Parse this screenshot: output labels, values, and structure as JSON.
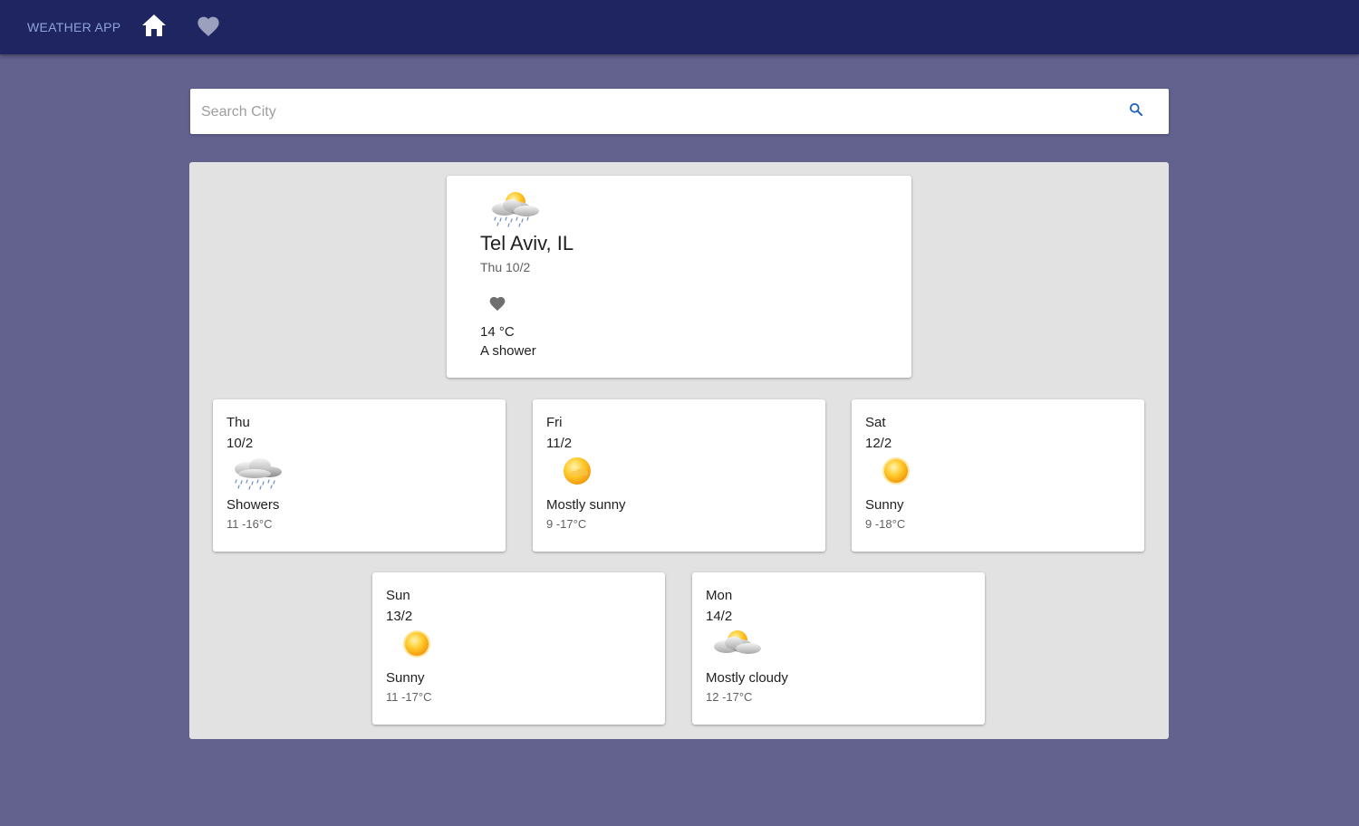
{
  "app": {
    "title": "WEATHER APP",
    "home_icon": "home-icon",
    "favorites_icon": "heart-icon",
    "colors": {
      "appbar": "#1f2561",
      "background": "#63618e",
      "panel": "#e2e2e2",
      "search_icon": "#1e63c4"
    }
  },
  "search": {
    "placeholder": "Search City",
    "value": "",
    "icon": "search-icon"
  },
  "current": {
    "city": "Tel Aviv, IL",
    "date": "Thu 10/2",
    "temperature": "14 °C",
    "condition": "A shower",
    "icon": "cloud-sun-rain-icon",
    "favorite_icon": "heart-icon"
  },
  "forecast": [
    {
      "day": "Thu",
      "date": "10/2",
      "condition": "Showers",
      "range": "11 -16°C",
      "icon": "showers-icon"
    },
    {
      "day": "Fri",
      "date": "11/2",
      "condition": "Mostly sunny",
      "range": "9 -17°C",
      "icon": "mostly-sunny-icon"
    },
    {
      "day": "Sat",
      "date": "12/2",
      "condition": "Sunny",
      "range": "9 -18°C",
      "icon": "sun-icon"
    },
    {
      "day": "Sun",
      "date": "13/2",
      "condition": "Sunny",
      "range": "11 -17°C",
      "icon": "sun-icon"
    },
    {
      "day": "Mon",
      "date": "14/2",
      "condition": "Mostly cloudy",
      "range": "12 -17°C",
      "icon": "mostly-cloudy-icon"
    }
  ]
}
